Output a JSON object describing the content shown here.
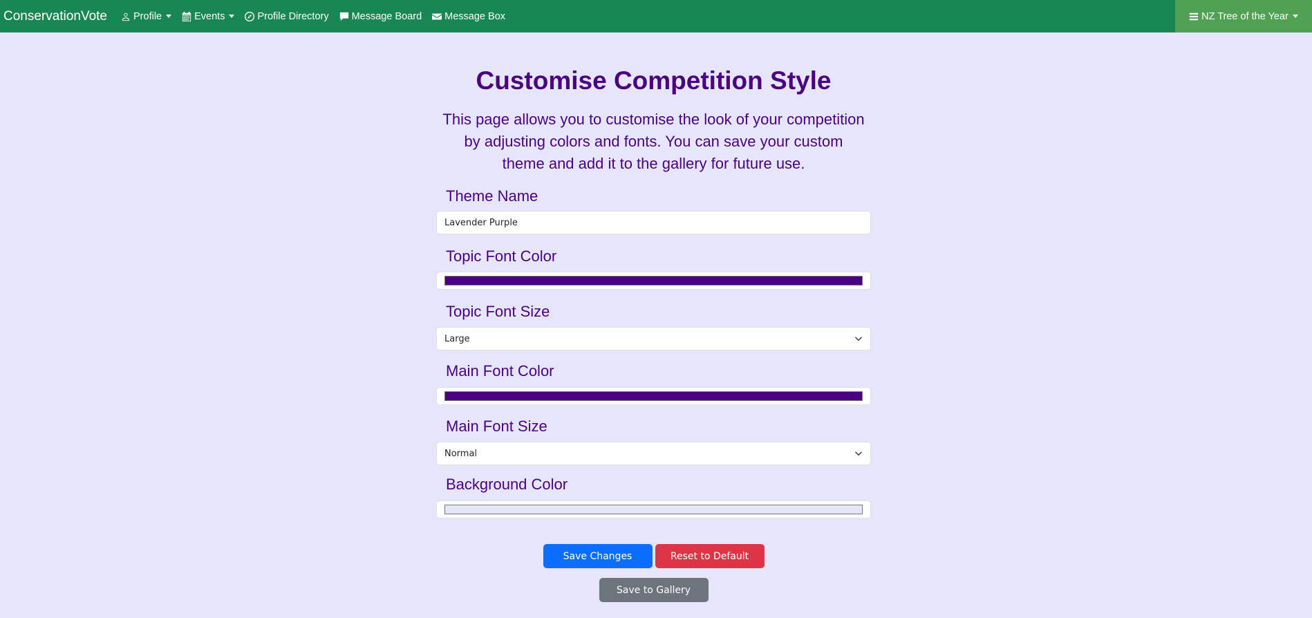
{
  "navbar": {
    "brand": "ConservationVote",
    "items": [
      {
        "label": "Profile",
        "icon": "user-icon",
        "dropdown": true
      },
      {
        "label": "Events",
        "icon": "calendar-icon",
        "dropdown": true
      },
      {
        "label": "Profile Directory",
        "icon": "compass-icon",
        "dropdown": false
      },
      {
        "label": "Message Board",
        "icon": "chat-icon",
        "dropdown": false
      },
      {
        "label": "Message Box",
        "icon": "envelope-icon",
        "dropdown": false
      }
    ],
    "right_label": "NZ Tree of the Year",
    "right_icon": "list-icon",
    "bg_color": "#198754",
    "right_bg_color": "#51a155"
  },
  "main": {
    "title": "Customise Competition Style",
    "description": "This page allows you to customise the look of your competition by adjusting colors and fonts. You can save your custom theme and add it to the gallery for future use.",
    "fields": {
      "theme_name": {
        "label": "Theme Name",
        "value": "Lavender Purple"
      },
      "topic_font_color": {
        "label": "Topic Font Color",
        "value": "#4b0082"
      },
      "topic_font_size": {
        "label": "Topic Font Size",
        "value": "Large"
      },
      "main_font_color": {
        "label": "Main Font Color",
        "value": "#4b0082"
      },
      "main_font_size": {
        "label": "Main Font Size",
        "value": "Normal"
      },
      "background_color": {
        "label": "Background Color",
        "value": "#e6e6fa"
      }
    },
    "buttons": {
      "save": "Save Changes",
      "reset": "Reset to Default",
      "gallery": "Save to Gallery"
    }
  }
}
